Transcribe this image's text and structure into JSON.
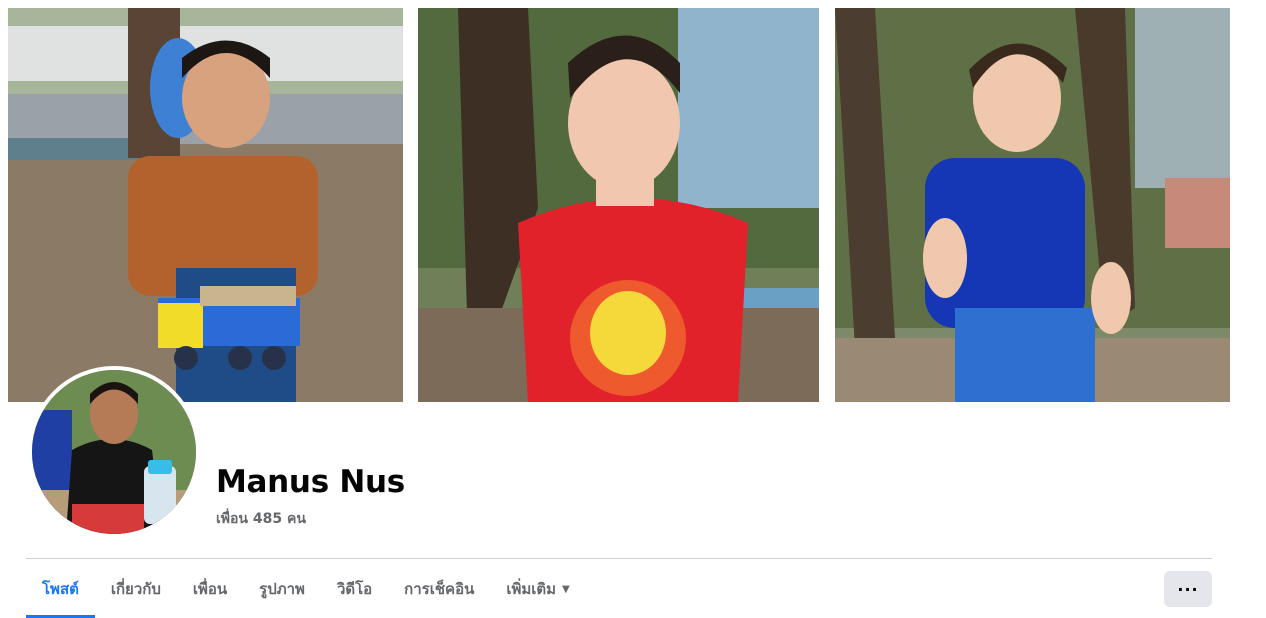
{
  "profile": {
    "name": "Manus Nus",
    "friends": "เพื่อน 485 คน"
  },
  "nav": {
    "tabs": [
      {
        "label": "โพสต์",
        "active": true
      },
      {
        "label": "เกี่ยวกับ"
      },
      {
        "label": "เพื่อน"
      },
      {
        "label": "รูปภาพ"
      },
      {
        "label": "วิดีโอ"
      },
      {
        "label": "การเช็คอิน"
      },
      {
        "label": "เพิ่มเติม",
        "dropdown": true
      }
    ],
    "more_button": "···"
  },
  "colors": {
    "accent": "#1877f2",
    "secondary_text": "#65676b",
    "button_bg": "#e4e6eb"
  }
}
